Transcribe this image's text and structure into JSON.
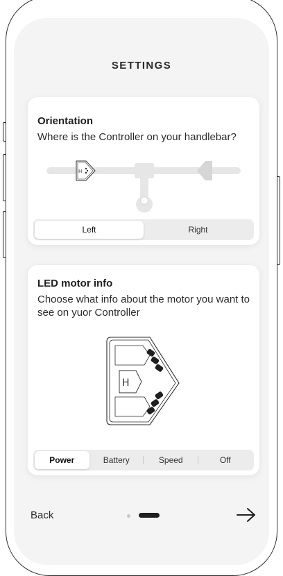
{
  "header": {
    "title": "SETTINGS"
  },
  "orientation": {
    "title": "Orientation",
    "description": "Where is the Controller on your handlebar?",
    "options": [
      "Left",
      "Right"
    ],
    "selected": "Left",
    "controller_icon": "controller-icon"
  },
  "led": {
    "title": "LED motor info",
    "description": "Choose what info about the motor you want to see on yuor Controller",
    "options": [
      "Power",
      "Battery",
      "Speed",
      "Off"
    ],
    "selected": "Power",
    "controller_icon": "controller-led-icon"
  },
  "footer": {
    "back_label": "Back",
    "page_indicator": {
      "pages": 2,
      "current": 2
    },
    "next_icon": "arrow-right-icon"
  },
  "colors": {
    "screen_bg": "#f4f4f4",
    "card_bg": "#ffffff",
    "accent": "#1f1f1f",
    "segment_bg": "#ececec"
  }
}
